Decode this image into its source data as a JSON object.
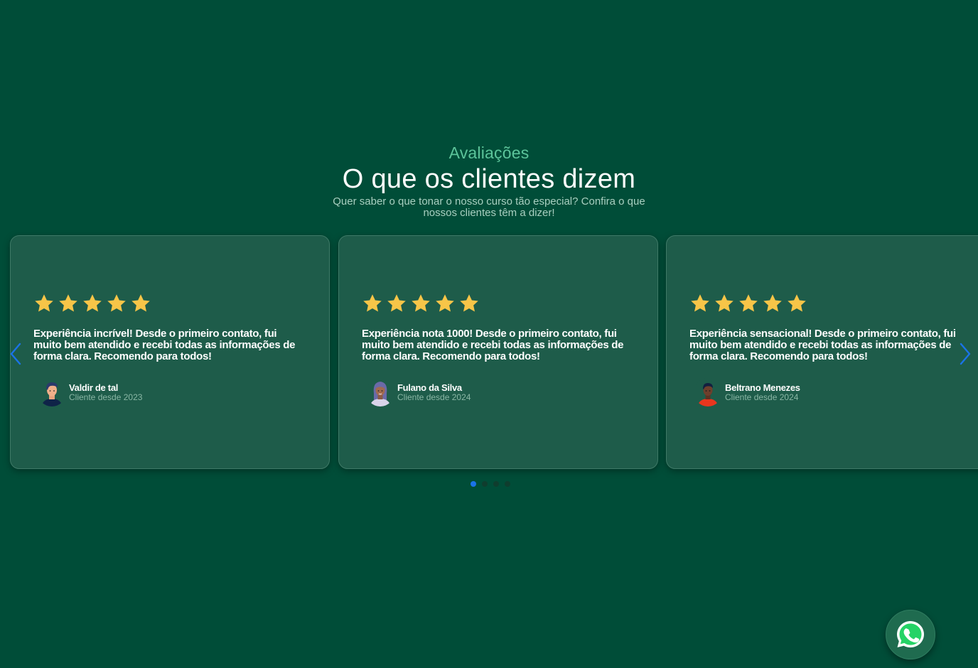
{
  "header": {
    "eyebrow": "Avaliações",
    "title": "O que os clientes dizem",
    "subtitle": "Quer saber o que tonar o nosso curso tão especial? Confira o que nossos clientes têm a dizer!"
  },
  "colors": {
    "background": "#004d38",
    "card": "#1e5c4a",
    "accent": "#5cc49a",
    "star": "#f7c548",
    "dot_active": "#1a73e8"
  },
  "testimonials": [
    {
      "rating": 5,
      "text": "Experiência incrível! Desde o primeiro contato, fui muito bem atendido e recebi todas as informações de forma clara. Recomendo para todos!",
      "name": "Valdir de tal",
      "since": "Cliente desde 2023",
      "avatar_icon": "man-avatar-icon"
    },
    {
      "rating": 5,
      "text": "Experiência nota 1000! Desde o primeiro contato, fui muito bem atendido e recebi todas as informações de forma clara. Recomendo para todos!",
      "name": "Fulano da Silva",
      "since": "Cliente desde 2024",
      "avatar_icon": "woman-avatar-icon"
    },
    {
      "rating": 5,
      "text": "Experiência sensacional! Desde o primeiro contato, fui muito bem atendido e recebi todas as informações de forma clara. Recomendo para todos!",
      "name": "Beltrano Menezes",
      "since": "Cliente desde 2024",
      "avatar_icon": "man-avatar-icon"
    }
  ],
  "carousel": {
    "pages": 4,
    "active_page": 1
  },
  "floating": {
    "icon": "whatsapp-icon"
  }
}
